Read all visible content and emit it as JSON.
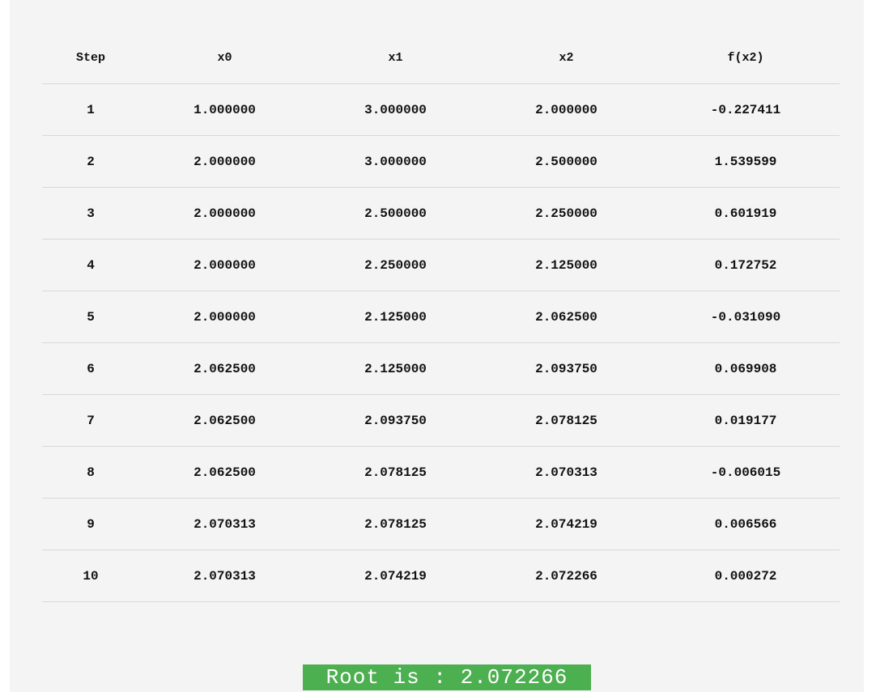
{
  "table": {
    "headers": [
      "Step",
      "x0",
      "x1",
      "x2",
      "f(x2)"
    ],
    "rows": [
      [
        "1",
        "1.000000",
        "3.000000",
        "2.000000",
        "-0.227411"
      ],
      [
        "2",
        "2.000000",
        "3.000000",
        "2.500000",
        "1.539599"
      ],
      [
        "3",
        "2.000000",
        "2.500000",
        "2.250000",
        "0.601919"
      ],
      [
        "4",
        "2.000000",
        "2.250000",
        "2.125000",
        "0.172752"
      ],
      [
        "5",
        "2.000000",
        "2.125000",
        "2.062500",
        "-0.031090"
      ],
      [
        "6",
        "2.062500",
        "2.125000",
        "2.093750",
        "0.069908"
      ],
      [
        "7",
        "2.062500",
        "2.093750",
        "2.078125",
        "0.019177"
      ],
      [
        "8",
        "2.062500",
        "2.078125",
        "2.070313",
        "-0.006015"
      ],
      [
        "9",
        "2.070313",
        "2.078125",
        "2.074219",
        "0.006566"
      ],
      [
        "10",
        "2.070313",
        "2.074219",
        "2.072266",
        "0.000272"
      ]
    ]
  },
  "result": {
    "text": "Root is : 2.072266"
  },
  "colors": {
    "panel_background": "#f4f4f4",
    "result_background": "#4caf50",
    "result_text": "#ffffff",
    "row_divider": "#d8d8d8"
  }
}
